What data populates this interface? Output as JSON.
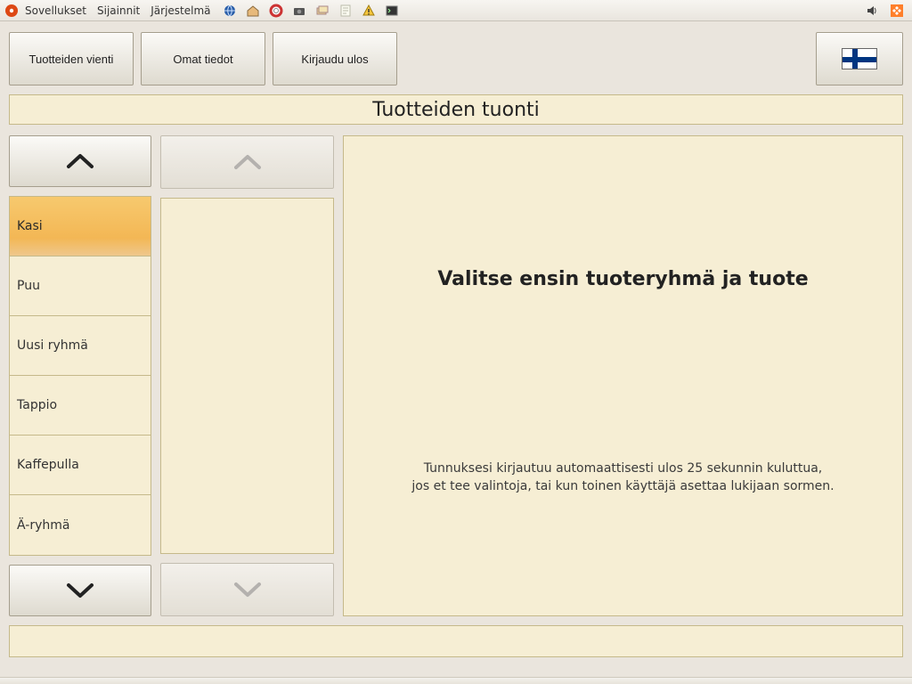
{
  "panel": {
    "menus": [
      "Sovellukset",
      "Sijainnit",
      "Järjestelmä"
    ],
    "right_icons": [
      "volume-icon",
      "ubuntu-icon"
    ]
  },
  "toolbar": {
    "export_label": "Tuotteiden vienti",
    "own_info_label": "Omat tiedot",
    "logout_label": "Kirjaudu ulos"
  },
  "title": "Tuotteiden tuonti",
  "categories": [
    {
      "label": "Kasi",
      "selected": true
    },
    {
      "label": "Puu"
    },
    {
      "label": "Uusi ryhmä"
    },
    {
      "label": "Tappio"
    },
    {
      "label": "Kaffepulla"
    },
    {
      "label": "Ä-ryhmä"
    }
  ],
  "content": {
    "headline": "Valitse ensin tuoteryhmä ja tuote",
    "info_line1": "Tunnuksesi kirjautuu automaattisesti ulos 25 sekunnin kuluttua,",
    "info_line2": "jos et tee valintoja, tai kun toinen käyttäjä asettaa lukijaan sormen."
  },
  "locale_flag": "fi"
}
